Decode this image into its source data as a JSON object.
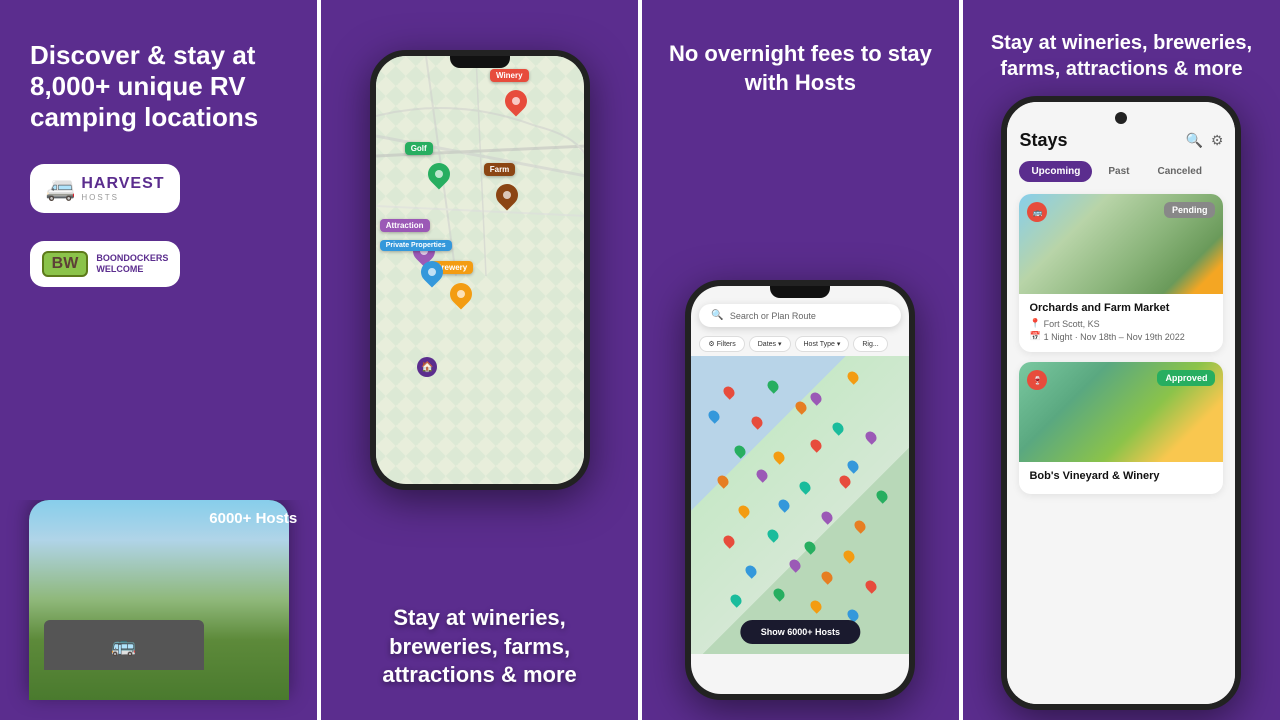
{
  "panel1": {
    "heading": "Discover & stay at 8,000+ unique RV camping locations",
    "harvest_hosts_label": "HARVEST",
    "harvest_sub": "HOSTS",
    "boondockers_label": "BW",
    "boondockers_sub": "BOONDOCKERS\nWELCOME",
    "hosts_count": "6000+ Hosts"
  },
  "panel2": {
    "bottom_text_line1": "Stay at wineries,",
    "bottom_text_line2": "breweries, farms,",
    "bottom_text_line3": "attractions & more",
    "pins": [
      {
        "label": "Winery",
        "color": "#e74c3c"
      },
      {
        "label": "Golf",
        "color": "#27ae60"
      },
      {
        "label": "Farm",
        "color": "#8b4513"
      },
      {
        "label": "Attraction",
        "color": "#9b59b6"
      },
      {
        "label": "Brewery",
        "color": "#f39c12"
      },
      {
        "label": "Private Properties",
        "color": "#3498db"
      }
    ]
  },
  "panel3": {
    "heading": "No overnight fees to stay with Hosts",
    "search_placeholder": "Search or Plan Route",
    "filters": [
      "Filters",
      "Dates ▾",
      "Host Type ▾",
      "Rig..."
    ],
    "show_hosts_button": "Show 6000+ Hosts"
  },
  "panel4": {
    "heading": "Stay at wineries, breweries, farms, attractions & more",
    "title": "Stays",
    "tabs": [
      "Upcoming",
      "Past",
      "Canceled"
    ],
    "active_tab": "Upcoming",
    "icons": [
      "🔍",
      "⚙"
    ],
    "cards": [
      {
        "name": "Orchards and Farm Market",
        "location": "Fort Scott, KS",
        "dates": "1 Night · Nov 18th – Nov 19th 2022",
        "badge": "Pending",
        "badge_type": "pending"
      },
      {
        "name": "Bob's Vineyard & Winery",
        "location": "",
        "dates": "",
        "badge": "Approved",
        "badge_type": "approved"
      }
    ]
  }
}
